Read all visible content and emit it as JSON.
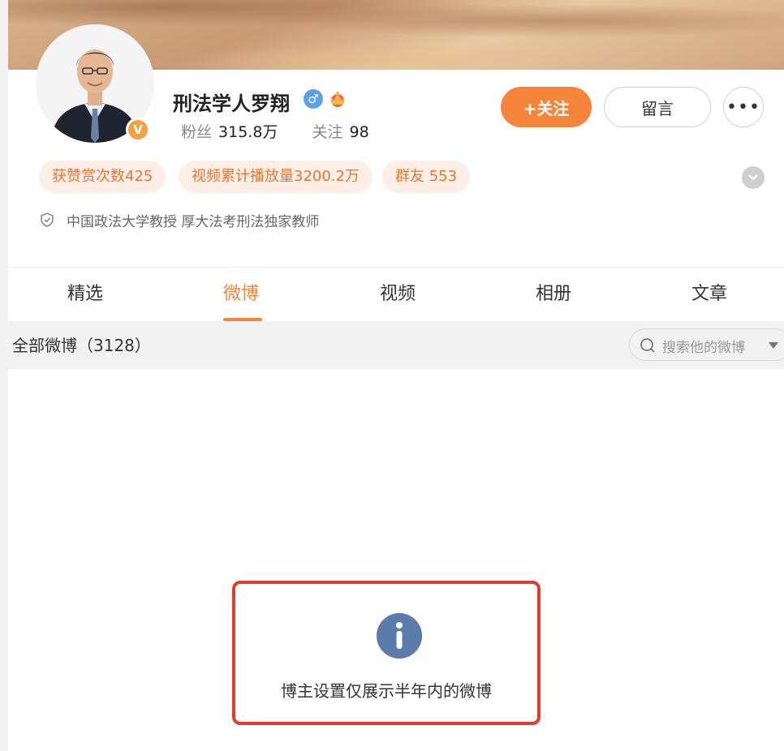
{
  "profile": {
    "name": "刑法学人罗翔",
    "badge_v": "V",
    "gender_symbol": "♂",
    "fans_label": "粉丝",
    "fans_count": "315.8万",
    "follow_label": "关注",
    "follow_count": "98",
    "description": "中国政法大学教授 厚大法考刑法独家教师"
  },
  "actions": {
    "follow": "+关注",
    "message": "留言",
    "more": "•••"
  },
  "tags": [
    "获赞赏次数425",
    "视频累计播放量3200.2万",
    "群友 553"
  ],
  "tabs": [
    "精选",
    "微博",
    "视频",
    "相册",
    "文章"
  ],
  "active_tab": "微博",
  "feed": {
    "title": "全部微博（3128）",
    "search_placeholder": "搜索他的微博"
  },
  "notice": {
    "text": "博主设置仅展示半年内的微博"
  },
  "colors": {
    "accent": "#f5853a",
    "tag_bg": "#fdeee6",
    "notice_border": "#e53b2f",
    "info_icon": "#5b7bab"
  }
}
